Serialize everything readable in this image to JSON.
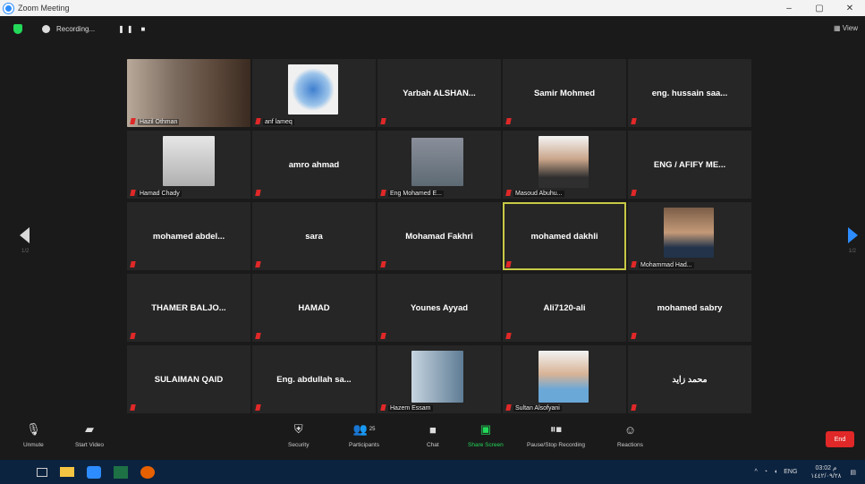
{
  "window": {
    "title": "Zoom Meeting",
    "minimize": "–",
    "maximize": "▢",
    "close": "✕"
  },
  "topbar": {
    "recording_label": "Recording...",
    "pause": "❚❚",
    "stop": "■",
    "view_label": "View"
  },
  "pager": {
    "left": "1/2",
    "right": "1/2"
  },
  "tiles": [
    {
      "kind": "video",
      "label": "Hazil Othman"
    },
    {
      "kind": "video",
      "label": "anf lameq"
    },
    {
      "kind": "name",
      "name": "Yarbah  ALSHAN..."
    },
    {
      "kind": "name",
      "name": "Samir Mohmed"
    },
    {
      "kind": "name",
      "name": "eng. hussain saa..."
    },
    {
      "kind": "video",
      "label": "Hamad Chady"
    },
    {
      "kind": "name",
      "name": "amro ahmad"
    },
    {
      "kind": "video",
      "label": "Eng Mohamed E..."
    },
    {
      "kind": "video",
      "label": "Masoud Abuhu..."
    },
    {
      "kind": "name",
      "name": "ENG / AFIFY ME..."
    },
    {
      "kind": "name",
      "name": "mohamed  abdel..."
    },
    {
      "kind": "name",
      "name": "sara"
    },
    {
      "kind": "name",
      "name": "Mohamad Fakhri"
    },
    {
      "kind": "name",
      "name": "mohamed dakhli",
      "active": true
    },
    {
      "kind": "video",
      "label": "Mohammad Had..."
    },
    {
      "kind": "name",
      "name": "THAMER  BALJO..."
    },
    {
      "kind": "name",
      "name": "HAMAD"
    },
    {
      "kind": "name",
      "name": "Younes Ayyad"
    },
    {
      "kind": "name",
      "name": "Ali7120-ali"
    },
    {
      "kind": "name",
      "name": "mohamed sabry"
    },
    {
      "kind": "name",
      "name": "SULAIMAN QAID"
    },
    {
      "kind": "name",
      "name": "Eng. abdullah sa..."
    },
    {
      "kind": "video",
      "label": "Hazem Essam"
    },
    {
      "kind": "video",
      "label": "Sultan Alsofyani"
    },
    {
      "kind": "name",
      "name": "محمد زايد"
    }
  ],
  "toolbar": {
    "unmute": "Unmute",
    "start_video": "Start Video",
    "security": "Security",
    "participants": "Participants",
    "participants_count": "25",
    "chat": "Chat",
    "share_screen": "Share Screen",
    "pause_recording": "Pause/Stop Recording",
    "reactions": "Reactions",
    "end": "End"
  },
  "taskbar": {
    "lang": "ENG",
    "time": "03:02 م",
    "date": "١٤٤٢/٠٩/٢٨"
  },
  "colors": {
    "active_speaker": "#c7c945",
    "mic_muted": "#e02828",
    "share_green": "#23d959",
    "end_red": "#e02828",
    "accent": "#2d8cff"
  }
}
